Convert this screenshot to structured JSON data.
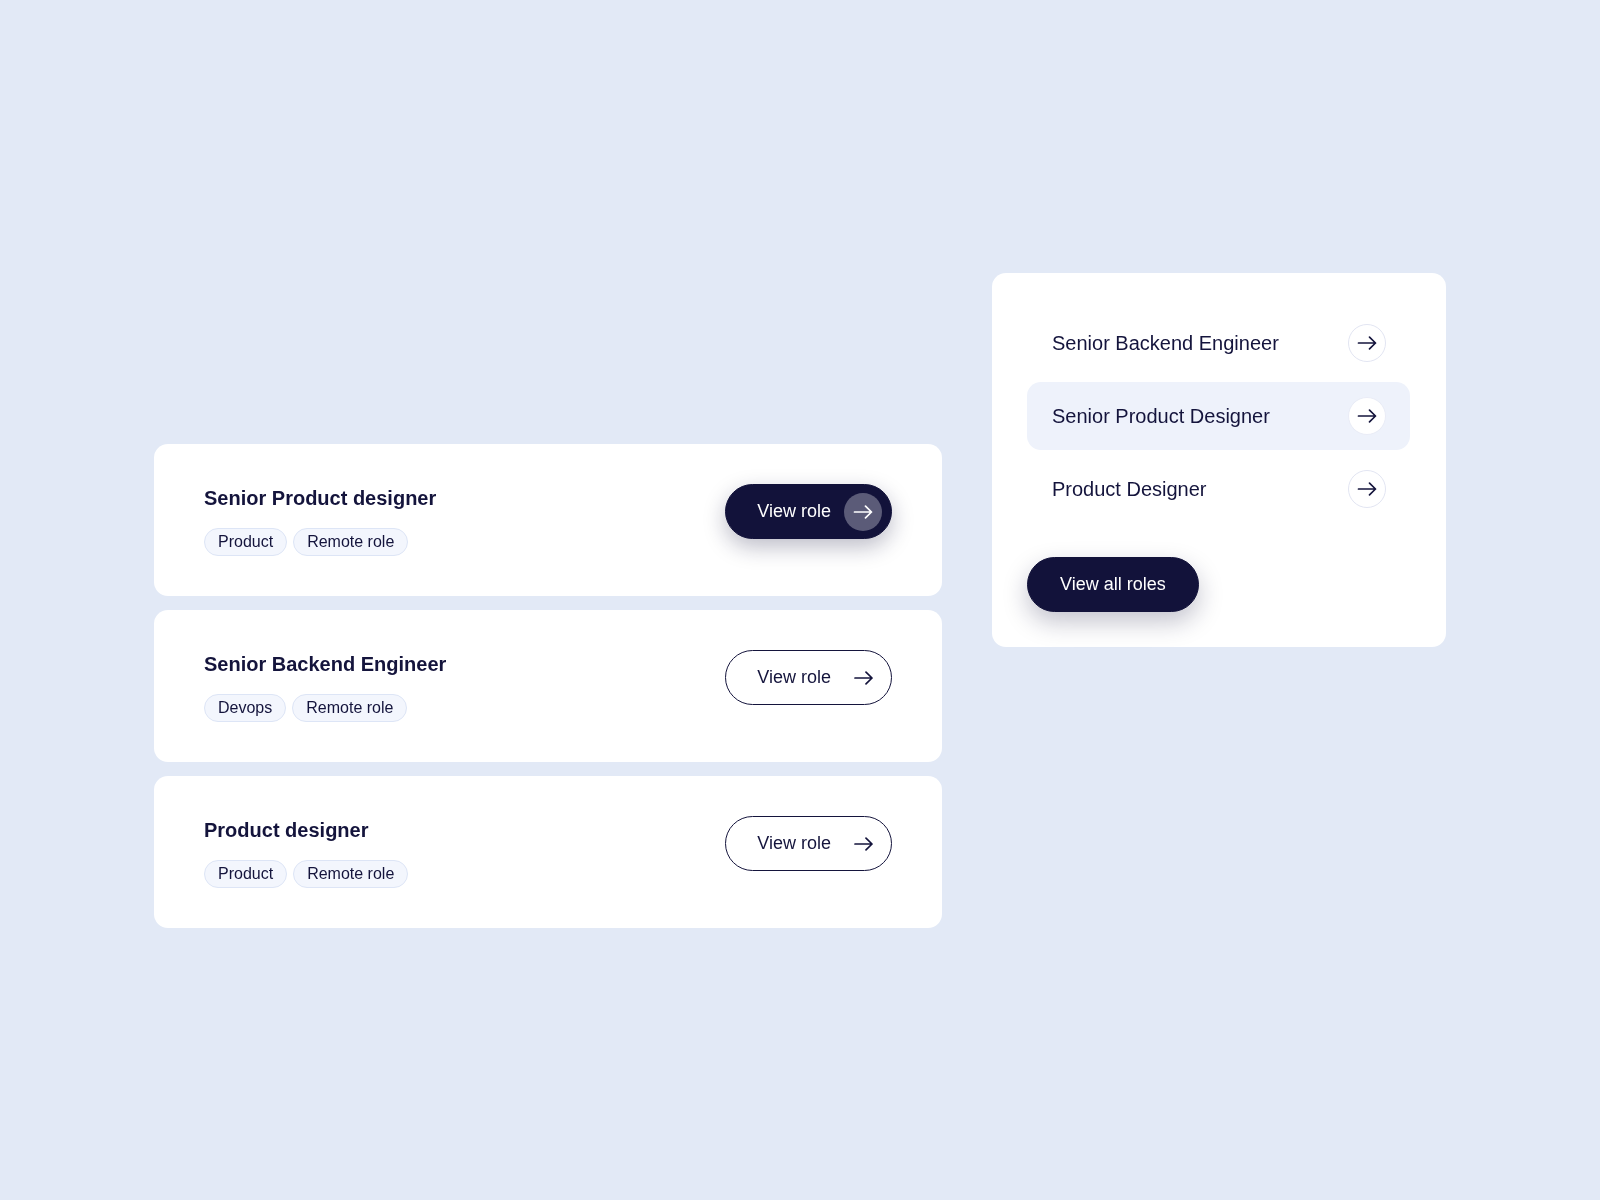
{
  "jobs": [
    {
      "title": "Senior Product designer",
      "tags": [
        "Product",
        "Remote role"
      ],
      "button": {
        "label": "View role",
        "highlighted": true
      }
    },
    {
      "title": "Senior Backend Engineer",
      "tags": [
        "Devops",
        "Remote role"
      ],
      "button": {
        "label": "View role",
        "highlighted": false
      }
    },
    {
      "title": "Product designer",
      "tags": [
        "Product",
        "Remote role"
      ],
      "button": {
        "label": "View role",
        "highlighted": false
      }
    }
  ],
  "role_list": {
    "items": [
      {
        "label": "Senior Backend Engineer",
        "selected": false
      },
      {
        "label": "Senior Product Designer",
        "selected": true
      },
      {
        "label": "Product Designer",
        "selected": false
      }
    ],
    "button": {
      "label": "View all roles"
    }
  }
}
